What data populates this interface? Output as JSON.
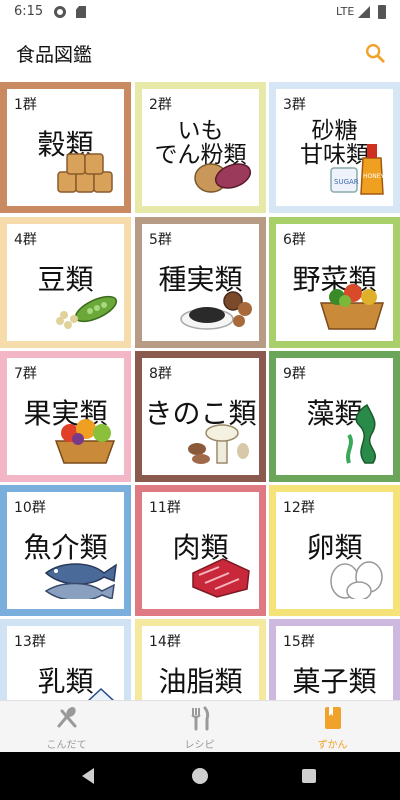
{
  "status_bar": {
    "time": "6:15",
    "network": "LTE"
  },
  "app_bar": {
    "title": "食品図鑑",
    "search_icon": "search-icon"
  },
  "tiles": [
    {
      "num": "1群",
      "name": "穀類",
      "color": "#c98a62"
    },
    {
      "num": "2群",
      "name": "いも\nでん粉類",
      "color": "#e6e9a8"
    },
    {
      "num": "3群",
      "name": "砂糖\n甘味類",
      "color": "#d6e6f5"
    },
    {
      "num": "4群",
      "name": "豆類",
      "color": "#f5dcaa"
    },
    {
      "num": "5群",
      "name": "種実類",
      "color": "#b89b84"
    },
    {
      "num": "6群",
      "name": "野菜類",
      "color": "#a8cf6a"
    },
    {
      "num": "7群",
      "name": "果実類",
      "color": "#f2b6c6"
    },
    {
      "num": "8群",
      "name": "きのこ類",
      "color": "#8a5a4e"
    },
    {
      "num": "9群",
      "name": "藻類",
      "color": "#6aa55a"
    },
    {
      "num": "10群",
      "name": "魚介類",
      "color": "#7aaedc"
    },
    {
      "num": "11群",
      "name": "肉類",
      "color": "#e07a82"
    },
    {
      "num": "12群",
      "name": "卵類",
      "color": "#f5e37a"
    },
    {
      "num": "13群",
      "name": "乳類",
      "color": "#cfe3f5"
    },
    {
      "num": "14群",
      "name": "油脂類",
      "color": "#f5e9a0"
    },
    {
      "num": "15群",
      "name": "菓子類",
      "color": "#cdb8e0"
    }
  ],
  "bottom_nav": [
    {
      "label": "こんだて",
      "icon": "spoon-knife-icon",
      "active": false
    },
    {
      "label": "レシピ",
      "icon": "fork-knife-icon",
      "active": false
    },
    {
      "label": "ずかん",
      "icon": "book-icon",
      "active": true
    }
  ],
  "accent_color": "#f0a22a"
}
